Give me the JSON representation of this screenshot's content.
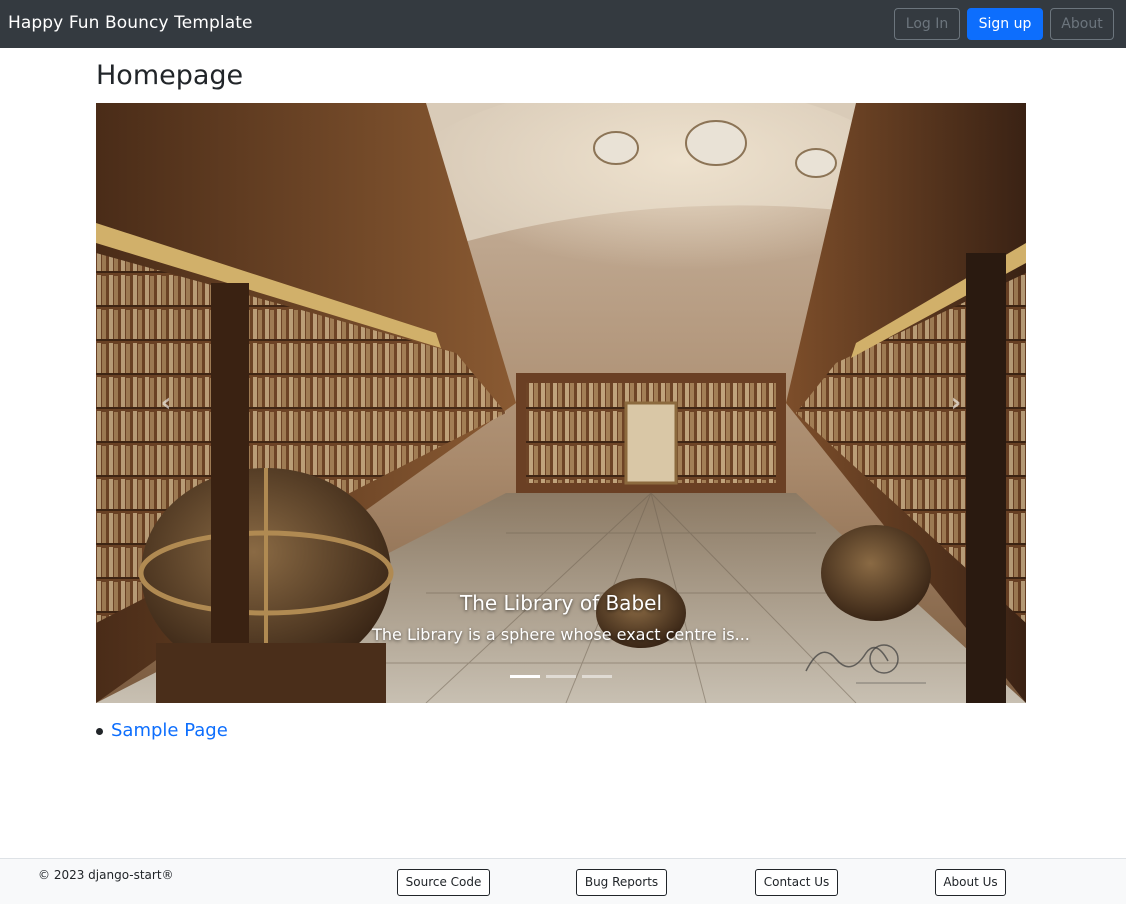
{
  "navbar": {
    "brand": "Happy Fun Bouncy Template",
    "login_label": "Log In",
    "signup_label": "Sign up",
    "about_label": "About"
  },
  "main": {
    "title": "Homepage",
    "carousel": {
      "caption_title": "The Library of Babel",
      "caption_text": "The Library is a sphere whose exact centre is...",
      "prev_icon": "chevron-left-icon",
      "next_icon": "chevron-right-icon",
      "prev_glyph": "‹",
      "next_glyph": "›",
      "slide_count": 3,
      "active_slide": 1
    },
    "links": [
      {
        "label": "Sample Page"
      }
    ]
  },
  "footer": {
    "copyright": "© 2023 django-start®",
    "buttons": {
      "source_code": "Source Code",
      "bug_reports": "Bug Reports",
      "contact_us": "Contact Us",
      "about_us": "About Us"
    }
  },
  "colors": {
    "navbar_bg": "#343a40",
    "primary": "#0d6efd",
    "secondary": "#6c757d",
    "footer_bg": "#f8f9fa"
  }
}
